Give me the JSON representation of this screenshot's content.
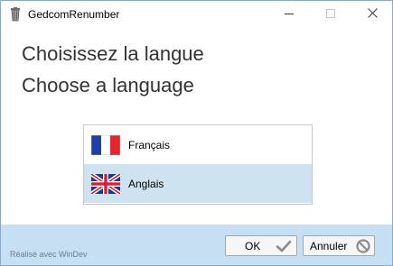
{
  "window": {
    "title": "GedcomRenumber",
    "app_icon": "trash-bin-icon"
  },
  "controls": {
    "minimize_icon": "minimize-icon",
    "maximize_icon": "maximize-icon",
    "close_icon": "close-icon"
  },
  "heading": {
    "line1": "Choisissez la langue",
    "line2": "Choose a language"
  },
  "languages": [
    {
      "label": "Français",
      "flag": "france-flag-icon",
      "selected": false
    },
    {
      "label": "Anglais",
      "flag": "uk-flag-icon",
      "selected": true
    }
  ],
  "footer": {
    "note": "Réalisé avec WinDev",
    "ok_label": "OK",
    "cancel_label": "Annuler",
    "ok_icon": "checkmark-icon",
    "cancel_icon": "no-entry-icon"
  },
  "colors": {
    "selected_row": "#cde3ef",
    "footer_bg": "#c7dff2",
    "heading_text": "#333333"
  }
}
